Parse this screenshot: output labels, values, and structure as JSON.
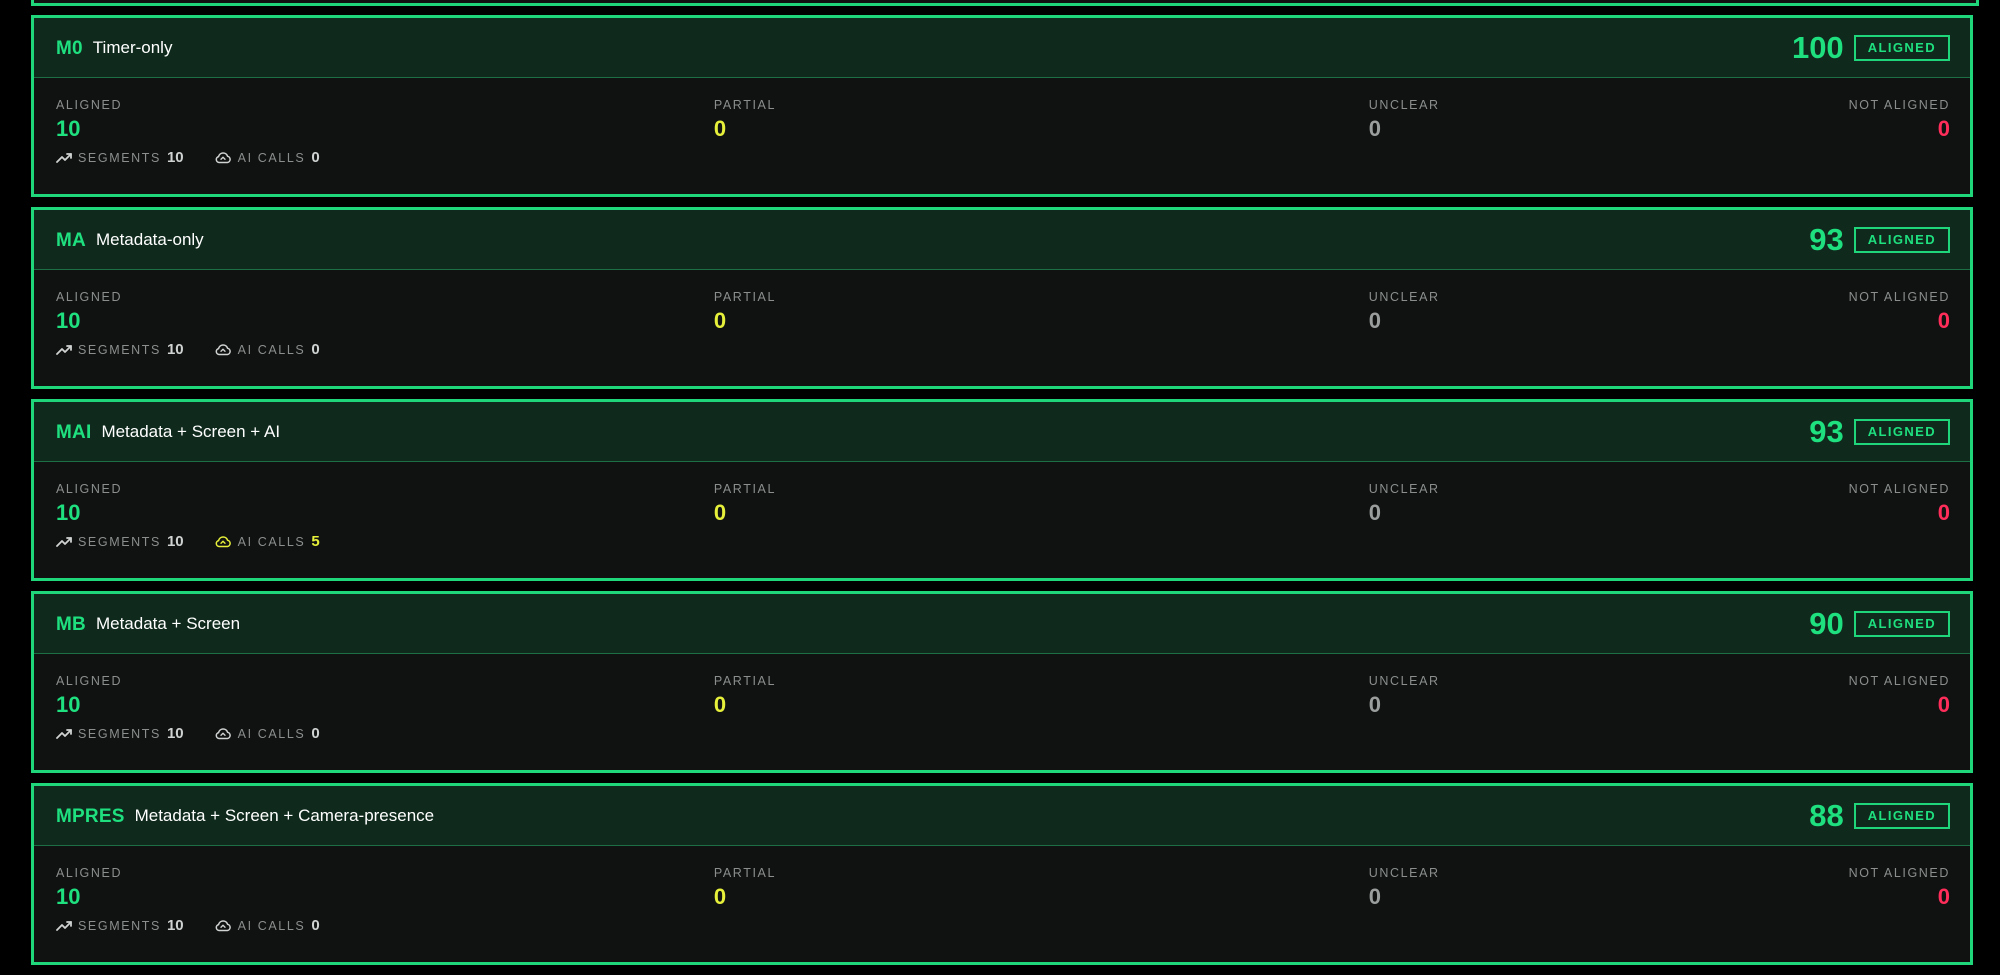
{
  "cards": [
    {
      "code": "M0",
      "name": "Timer-only",
      "score": "100",
      "badge": "ALIGNED",
      "stats": {
        "aligned": {
          "label": "ALIGNED",
          "value": "10"
        },
        "partial": {
          "label": "PARTIAL",
          "value": "0"
        },
        "unclear": {
          "label": "UNCLEAR",
          "value": "0"
        },
        "not_aligned": {
          "label": "NOT ALIGNED",
          "value": "0"
        }
      },
      "metrics": {
        "segments": {
          "label": "SEGMENTS",
          "value": "10"
        },
        "ai_calls": {
          "label": "AI CALLS",
          "value": "0"
        }
      }
    },
    {
      "code": "MA",
      "name": "Metadata-only",
      "score": "93",
      "badge": "ALIGNED",
      "stats": {
        "aligned": {
          "label": "ALIGNED",
          "value": "10"
        },
        "partial": {
          "label": "PARTIAL",
          "value": "0"
        },
        "unclear": {
          "label": "UNCLEAR",
          "value": "0"
        },
        "not_aligned": {
          "label": "NOT ALIGNED",
          "value": "0"
        }
      },
      "metrics": {
        "segments": {
          "label": "SEGMENTS",
          "value": "10"
        },
        "ai_calls": {
          "label": "AI CALLS",
          "value": "0"
        }
      }
    },
    {
      "code": "MAI",
      "name": "Metadata + Screen + AI",
      "score": "93",
      "badge": "ALIGNED",
      "stats": {
        "aligned": {
          "label": "ALIGNED",
          "value": "10"
        },
        "partial": {
          "label": "PARTIAL",
          "value": "0"
        },
        "unclear": {
          "label": "UNCLEAR",
          "value": "0"
        },
        "not_aligned": {
          "label": "NOT ALIGNED",
          "value": "0"
        }
      },
      "metrics": {
        "segments": {
          "label": "SEGMENTS",
          "value": "10"
        },
        "ai_calls": {
          "label": "AI CALLS",
          "value": "5"
        }
      }
    },
    {
      "code": "MB",
      "name": "Metadata + Screen",
      "score": "90",
      "badge": "ALIGNED",
      "stats": {
        "aligned": {
          "label": "ALIGNED",
          "value": "10"
        },
        "partial": {
          "label": "PARTIAL",
          "value": "0"
        },
        "unclear": {
          "label": "UNCLEAR",
          "value": "0"
        },
        "not_aligned": {
          "label": "NOT ALIGNED",
          "value": "0"
        }
      },
      "metrics": {
        "segments": {
          "label": "SEGMENTS",
          "value": "10"
        },
        "ai_calls": {
          "label": "AI CALLS",
          "value": "0"
        }
      }
    },
    {
      "code": "MPRES",
      "name": "Metadata + Screen + Camera-presence",
      "score": "88",
      "badge": "ALIGNED",
      "stats": {
        "aligned": {
          "label": "ALIGNED",
          "value": "10"
        },
        "partial": {
          "label": "PARTIAL",
          "value": "0"
        },
        "unclear": {
          "label": "UNCLEAR",
          "value": "0"
        },
        "not_aligned": {
          "label": "NOT ALIGNED",
          "value": "0"
        }
      },
      "metrics": {
        "segments": {
          "label": "SEGMENTS",
          "value": "10"
        },
        "ai_calls": {
          "label": "AI CALLS",
          "value": "0"
        }
      }
    }
  ],
  "icons": {
    "segments": "trend-up-icon",
    "ai_calls": "cloud-upload-icon"
  },
  "colors": {
    "accent": "#1fe07f",
    "partial": "#e6f03a",
    "unclear": "#9a9e9c",
    "not_aligned": "#ff2d5a",
    "card_border": "#1fd67a",
    "header_bg": "#0f2a1d",
    "body_bg": "#101111"
  }
}
